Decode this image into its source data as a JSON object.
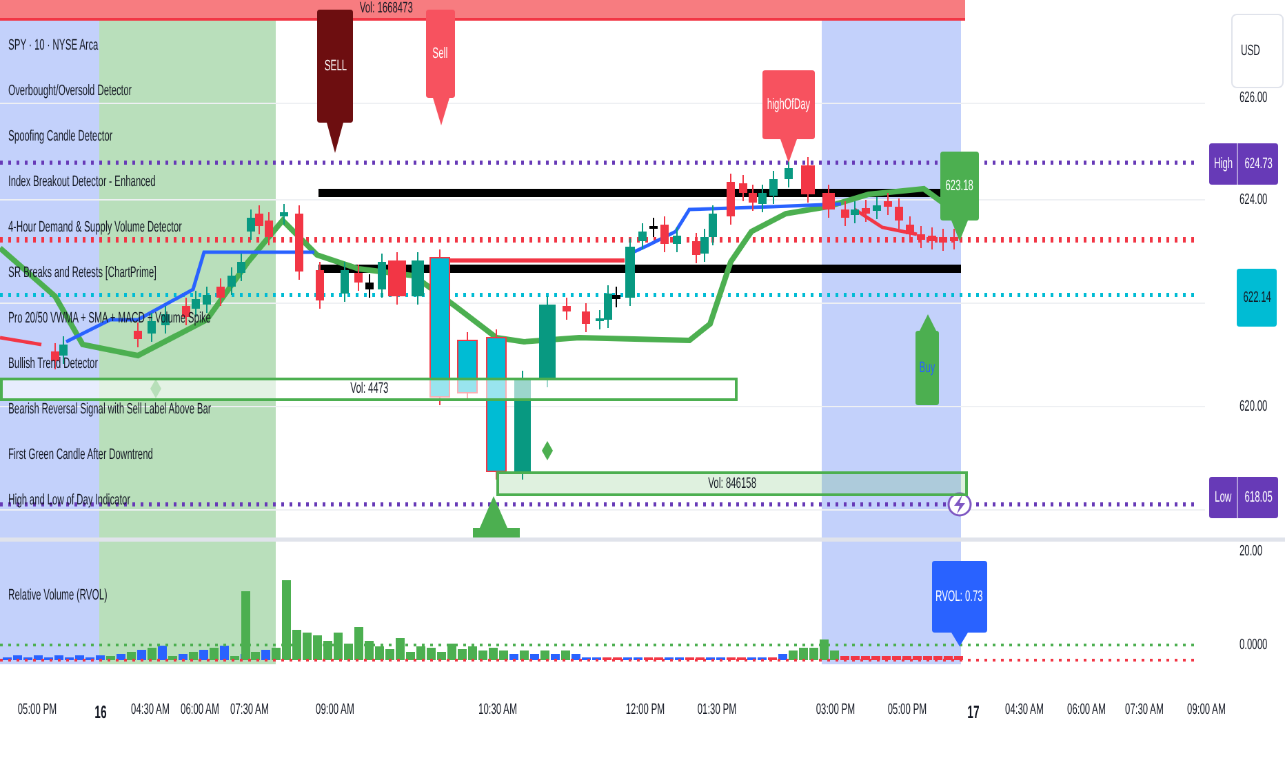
{
  "top_banner": {
    "text": "Vol: 1668473"
  },
  "legend": {
    "symbol": "SPY · 10 · NYSE Arca",
    "indicators": [
      "Overbought/Oversold Detector",
      "Spoofing Candle Detector",
      "Index Breakout Detector - Enhanced",
      "4-Hour Demand & Supply Volume Detector",
      "SR Breaks and Retests [ChartPrime]",
      "Pro 20/50 VWMA + SMA + MACD + Volume Spike",
      "Bullish Trend Detector",
      "Bearish Reversal Signal with Sell Label Above Bar",
      "First Green Candle After Downtrend",
      "High and Low of Day Indicator"
    ]
  },
  "chart_labels": [
    {
      "kind": "strong_sell",
      "text": "SELL"
    },
    {
      "kind": "sell",
      "text": "Sell"
    },
    {
      "kind": "sell",
      "text": "highOfDay"
    },
    {
      "kind": "price_down",
      "text": "623.18"
    },
    {
      "kind": "buy",
      "text": "Buy"
    }
  ],
  "volume_zones": [
    {
      "text": "Vol: 4473",
      "filled": false
    },
    {
      "text": "Vol: 846158",
      "filled": true
    }
  ],
  "price_axis": {
    "currency": "USD",
    "ticks": [
      "626.00",
      "624.00",
      "620.00"
    ],
    "markers": [
      {
        "kind": "high",
        "label": "High",
        "value": "624.73"
      },
      {
        "kind": "level",
        "value": "622.14"
      },
      {
        "kind": "low",
        "label": "Low",
        "value": "618.05"
      }
    ]
  },
  "volume_pane": {
    "title": "Relative Volume (RVOL)",
    "ticks": [
      "20.00",
      "0.0000"
    ],
    "badge": "RVOL: 0.73"
  },
  "time_axis": [
    {
      "text": "05:00 PM",
      "kind": "time"
    },
    {
      "text": "16",
      "kind": "day"
    },
    {
      "text": "04:30 AM",
      "kind": "time"
    },
    {
      "text": "06:00 AM",
      "kind": "time"
    },
    {
      "text": "07:30 AM",
      "kind": "time"
    },
    {
      "text": "09:00 AM",
      "kind": "time"
    },
    {
      "text": "10:30 AM",
      "kind": "time"
    },
    {
      "text": "12:00 PM",
      "kind": "time"
    },
    {
      "text": "01:30 PM",
      "kind": "time"
    },
    {
      "text": "03:00 PM",
      "kind": "time"
    },
    {
      "text": "05:00 PM",
      "kind": "time"
    },
    {
      "text": "17",
      "kind": "day"
    },
    {
      "text": "04:30 AM",
      "kind": "time"
    },
    {
      "text": "06:00 AM",
      "kind": "time"
    },
    {
      "text": "07:30 AM",
      "kind": "time"
    },
    {
      "text": "09:00 AM",
      "kind": "time"
    }
  ]
}
